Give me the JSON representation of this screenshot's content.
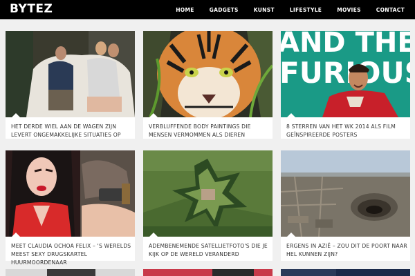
{
  "site": {
    "logo": "BYTEZ"
  },
  "nav": {
    "items": [
      "HOME",
      "GADGETS",
      "KUNST",
      "LIFESTYLE",
      "MOVIES",
      "CONTACT"
    ]
  },
  "articles": [
    {
      "title": "HET DERDE WIEL AAN DE WAGEN ZIJN LEVERT ONGEMAKKELIJKE SITUATIES OP"
    },
    {
      "title": "VERBLUFFENDE BODY PAINTINGS DIE MENSEN VERMOMMEN ALS DIEREN"
    },
    {
      "title": "8 STERREN VAN HET WK 2014 ALS FILM GEÏNSPIREERDE POSTERS",
      "image_text": "AND THE FURIOUS"
    },
    {
      "title": "MEET CLAUDIA OCHOA FELIX – 'S WERELDS MEEST SEXY DRUGSKARTEL HUURMOORDENAAR"
    },
    {
      "title": "ADEMBENEMENDE SATELLIETFOTO'S DIE JE KIJK OP DE WERELD VERANDERD"
    },
    {
      "title": "ERGENS IN AZIË – ZOU DIT DE POORT NAAR HEL KUNNEN ZIJN?"
    }
  ]
}
